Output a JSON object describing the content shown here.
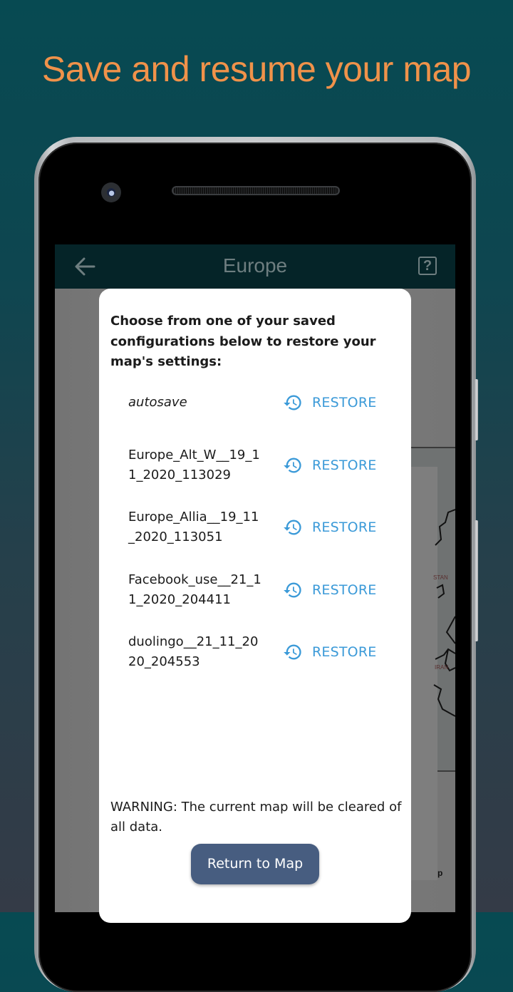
{
  "promo": {
    "headline": "Save and resume your map"
  },
  "colors": {
    "headline": "#f0924a",
    "restore_accent": "#3b9ad8",
    "primary_button": "#475d80",
    "appbar": "#052428"
  },
  "appbar": {
    "title": "Europe",
    "back_icon": "arrow-left-icon",
    "help_icon": "help-box-icon",
    "help_glyph": "?"
  },
  "map_background": {
    "labels": [
      "STAN",
      "IRAN",
      "p"
    ]
  },
  "dialog": {
    "prompt": "Choose from one of your saved configurations below to restore your map's settings:",
    "saves": [
      {
        "name": "autosave",
        "italic": true,
        "action": "RESTORE",
        "icon": "history-icon"
      },
      {
        "name": "Europe_Alt_W__19_11_2020_113029",
        "italic": false,
        "action": "RESTORE",
        "icon": "history-icon"
      },
      {
        "name": "Europe_Allia__19_11_2020_113051",
        "italic": false,
        "action": "RESTORE",
        "icon": "history-icon"
      },
      {
        "name": "Facebook_use__21_11_2020_204411",
        "italic": false,
        "action": "RESTORE",
        "icon": "history-icon"
      },
      {
        "name": "duolingo__21_11_2020_204553",
        "italic": false,
        "action": "RESTORE",
        "icon": "history-icon"
      }
    ],
    "warning": "WARNING: The current map will be cleared of all data.",
    "return_button": "Return to Map"
  }
}
